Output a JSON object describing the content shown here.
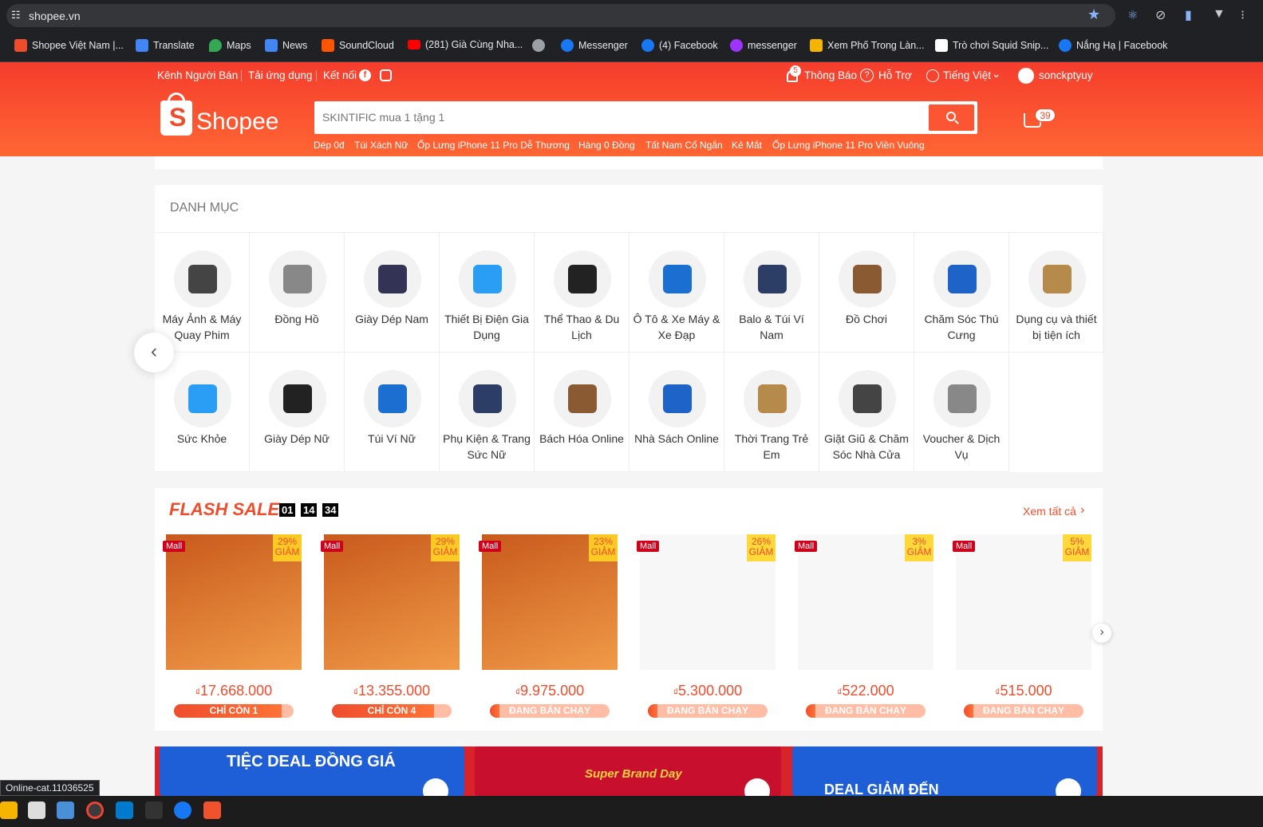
{
  "browser": {
    "url": "shopee.vn",
    "bookmarks": [
      "Shopee Việt Nam |...",
      "Translate",
      "Maps",
      "News",
      "SoundCloud",
      "(281) Già Cùng Nha...",
      "",
      "Messenger",
      "(4) Facebook",
      "messenger",
      "Xem Phố Trong Làn...",
      "Trò chơi Squid Snip...",
      "Nắng Hạ | Facebook"
    ]
  },
  "topnav": {
    "seller": "Kênh Người Bán",
    "app": "Tải ứng dụng",
    "connect": "Kết nối",
    "notify": "Thông Báo",
    "notify_count": "5",
    "help": "Hỗ Trợ",
    "lang": "Tiếng Việt",
    "user": "sonckptyuy"
  },
  "brand": {
    "name": "Shopee",
    "accent": "#ee4d2d"
  },
  "search": {
    "placeholder": "SKINTIFIC mua 1 tặng 1"
  },
  "cart": {
    "count": "39"
  },
  "keywords": [
    "Dép 0đ",
    "Túi Xách Nữ",
    "Ốp Lưng iPhone 11 Pro Dễ Thương",
    "Hàng 0 Đồng",
    "Tất Nam Cổ Ngắn",
    "Kẻ Mắt",
    "Ốp Lưng iPhone 11 Pro Viền Vuông"
  ],
  "categories": {
    "title": "DANH MỤC",
    "row1": [
      "Máy Ảnh & Máy Quay Phim",
      "Đồng Hồ",
      "Giày Dép Nam",
      "Thiết Bị Điện Gia Dụng",
      "Thể Thao & Du Lịch",
      "Ô Tô & Xe Máy & Xe Đạp",
      "Balo & Túi Ví Nam",
      "Đồ Chơi",
      "Chăm Sóc Thú Cưng",
      "Dụng cụ và thiết bị tiện ích"
    ],
    "row2": [
      "Sức Khỏe",
      "Giày Dép Nữ",
      "Túi Ví Nữ",
      "Phụ Kiện & Trang Sức Nữ",
      "Bách Hóa Online",
      "Nhà Sách Online",
      "Thời Trang Trẻ Em",
      "Giặt Giũ & Chăm Sóc Nhà Cửa",
      "Voucher & Dịch Vụ"
    ]
  },
  "flash_sale": {
    "title": "FLASH SALE",
    "timer": [
      "01",
      "14",
      "34"
    ],
    "see_all": "Xem tất cả",
    "items": [
      {
        "price": "17.668.000",
        "discount": "29%",
        "status": "CHỈ CÒN 1",
        "sold_fraction": 0.9
      },
      {
        "price": "13.355.000",
        "discount": "29%",
        "status": "CHỈ CÒN 4",
        "sold_fraction": 0.85
      },
      {
        "price": "9.975.000",
        "discount": "23%",
        "status": "ĐANG BÁN CHẠY",
        "sold_fraction": 0.08
      },
      {
        "price": "5.300.000",
        "discount": "26%",
        "status": "ĐANG BÁN CHẠY",
        "sold_fraction": 0.08
      },
      {
        "price": "522.000",
        "discount": "3%",
        "status": "ĐANG BÁN CHẠY",
        "sold_fraction": 0.08
      },
      {
        "price": "515.000",
        "discount": "5%",
        "status": "ĐANG BÁN CHẠY",
        "sold_fraction": 0.08
      }
    ],
    "currency": "₫",
    "mall_label": "Mall",
    "discount_word": "GIẢM"
  },
  "banners": [
    "TIỆC DEAL ĐỒNG GIÁ",
    "Super Brand Day",
    "DEAL GIẢM ĐẾN"
  ],
  "status_tooltip": "Online-cat.11036525"
}
